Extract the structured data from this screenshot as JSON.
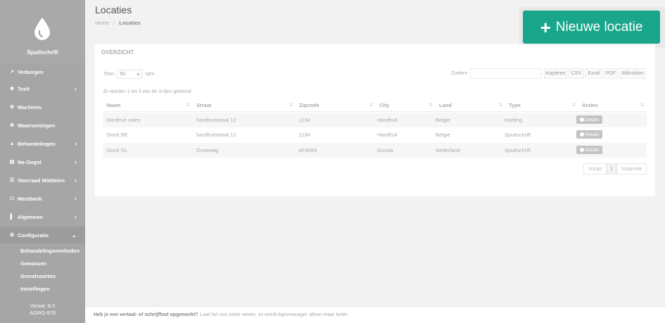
{
  "sidebar": {
    "brand_name": "Spuitschrift",
    "menu": [
      {
        "label": "Verbergen",
        "icon": "↗",
        "chevron": ""
      },
      {
        "label": "Teelt",
        "icon": "❀",
        "chevron": "‹"
      },
      {
        "label": "Machines",
        "icon": "⚙",
        "chevron": ""
      },
      {
        "label": "Waarnemingen",
        "icon": "✻",
        "chevron": ""
      },
      {
        "label": "Behandelingen",
        "icon": "▲",
        "chevron": "‹"
      },
      {
        "label": "Na-Oogst",
        "icon": "▤",
        "chevron": "‹"
      },
      {
        "label": "Voorraad Middelen",
        "icon": "☰",
        "chevron": "‹"
      },
      {
        "label": "Mestbank",
        "icon": "☖",
        "chevron": "‹"
      },
      {
        "label": "Algemeen",
        "icon": "▌",
        "chevron": "‹"
      },
      {
        "label": "Configuratie",
        "icon": "⚙",
        "chevron": "⌄"
      }
    ],
    "submenu": [
      "Behandelingseenheden",
      "Gewassen",
      "Grondsoorten",
      "Instellingen"
    ],
    "version_line1": "Versie: 8.0",
    "version_line2": "AGRO-970"
  },
  "header": {
    "title": "Locaties",
    "breadcrumb_home": "Home",
    "breadcrumb_sep": "/",
    "breadcrumb_current": "Locaties"
  },
  "new_button": {
    "plus": "+",
    "label": "Nieuwe locatie"
  },
  "panel": {
    "title": "OVERZICHT",
    "show_prefix": "Toon",
    "show_value": "50",
    "show_suffix": "rijen",
    "search_label": "Zoeken",
    "export_buttons": [
      "Kopiëren",
      "CSV",
      "Excel",
      "PDF",
      "Afdrukken"
    ],
    "info": "Er worden 1 tot 3 van de 3 rijen getoond",
    "columns": [
      "Naam",
      "Straat",
      "Zipcode",
      "City",
      "Land",
      "Type",
      "Acties"
    ],
    "rows": [
      [
        "Hardfruit sales",
        "hardfruitstraat 12",
        "1234",
        "Hardfruit",
        "Belgie",
        "Koeling",
        "Details"
      ],
      [
        "Stock BE",
        "hardfruitstraat 12",
        "1234",
        "Hardfruit",
        "Belgie",
        "Spuitschrift",
        "Details"
      ],
      [
        "Stock NL",
        "Ossewag",
        "AF4589",
        "Gouda",
        "Nederland",
        "Spuitschrift",
        "Details"
      ]
    ],
    "pagination": {
      "prev": "Vorige",
      "page": "1",
      "next": "Volgende"
    }
  },
  "footer": {
    "bold": "Heb je een vertaal- of schrijffout opgemerkt?",
    "text": "Laat het ons zeker weten, zo wordt Agromanager alleen maar beter."
  },
  "colors": {
    "accent": "#19a68a",
    "sidebar": "#a6a6a6"
  }
}
